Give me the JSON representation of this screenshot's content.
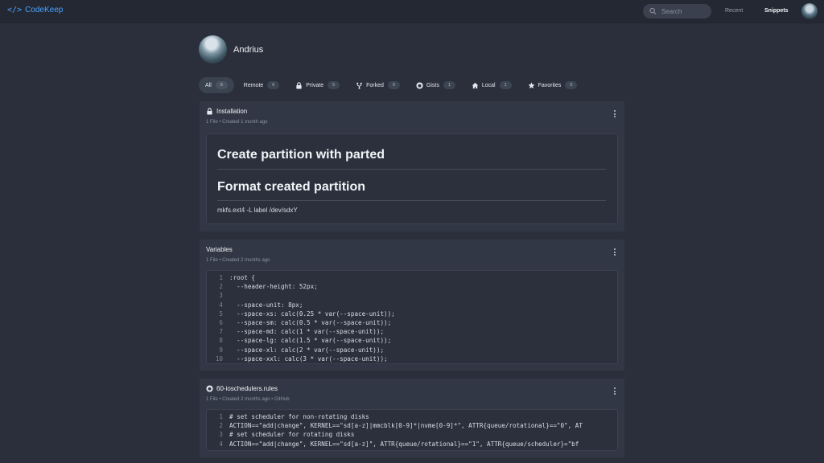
{
  "app": {
    "logo_symbol": "</>",
    "name": "CodeKeep"
  },
  "search": {
    "placeholder": "Search"
  },
  "nav": {
    "recent": "Recent",
    "snippets": "Snippets"
  },
  "profile": {
    "name": "Andrius"
  },
  "filters": [
    {
      "label": "All",
      "count": "8",
      "icon": ""
    },
    {
      "label": "Remote",
      "count": "6",
      "icon": ""
    },
    {
      "label": "Private",
      "count": "5",
      "icon": "lock-icon"
    },
    {
      "label": "Forked",
      "count": "0",
      "icon": "fork-icon"
    },
    {
      "label": "Gists",
      "count": "1",
      "icon": "github-icon"
    },
    {
      "label": "Local",
      "count": "1",
      "icon": "home-icon"
    },
    {
      "label": "Favorites",
      "count": "0",
      "icon": "star-icon"
    }
  ],
  "cards": [
    {
      "title": "Installation",
      "meta": "1 File • Created 1 month ago",
      "icon": "lock-icon",
      "content": {
        "h1": "Create partition with parted",
        "h2": "Format created partition",
        "p": "mkfs.ext4 -L label /dev/sdxY"
      }
    },
    {
      "title": "Variables",
      "meta": "1 File • Created 2 months ago",
      "lines": [
        {
          "n": "1",
          "code": ":root {"
        },
        {
          "n": "2",
          "code": "  --header-height: 52px;"
        },
        {
          "n": "3",
          "code": ""
        },
        {
          "n": "4",
          "code": "  --space-unit: 8px;"
        },
        {
          "n": "5",
          "code": "  --space-xs: calc(0.25 * var(--space-unit));"
        },
        {
          "n": "6",
          "code": "  --space-sm: calc(0.5 * var(--space-unit));"
        },
        {
          "n": "7",
          "code": "  --space-md: calc(1 * var(--space-unit));"
        },
        {
          "n": "8",
          "code": "  --space-lg: calc(1.5 * var(--space-unit));"
        },
        {
          "n": "9",
          "code": "  --space-xl: calc(2 * var(--space-unit));"
        },
        {
          "n": "10",
          "code": "  --space-xxl: calc(3 * var(--space-unit));"
        }
      ]
    },
    {
      "title": "60-ioschedulers.rules",
      "meta": "1 File • Created 2 months ago • GitHub",
      "icon": "github-icon",
      "lines": [
        {
          "n": "1",
          "code": "# set scheduler for non-rotating disks"
        },
        {
          "n": "2",
          "code": "ACTION==\"add|change\", KERNEL==\"sd[a-z]|mmcblk[0-9]*|nvme[0-9]*\", ATTR{queue/rotational}==\"0\", AT"
        },
        {
          "n": "3",
          "code": "# set scheduler for rotating disks"
        },
        {
          "n": "4",
          "code": "ACTION==\"add|change\", KERNEL==\"sd[a-z]\", ATTR{queue/rotational}==\"1\", ATTR{queue/scheduler}=\"bf"
        }
      ]
    }
  ]
}
